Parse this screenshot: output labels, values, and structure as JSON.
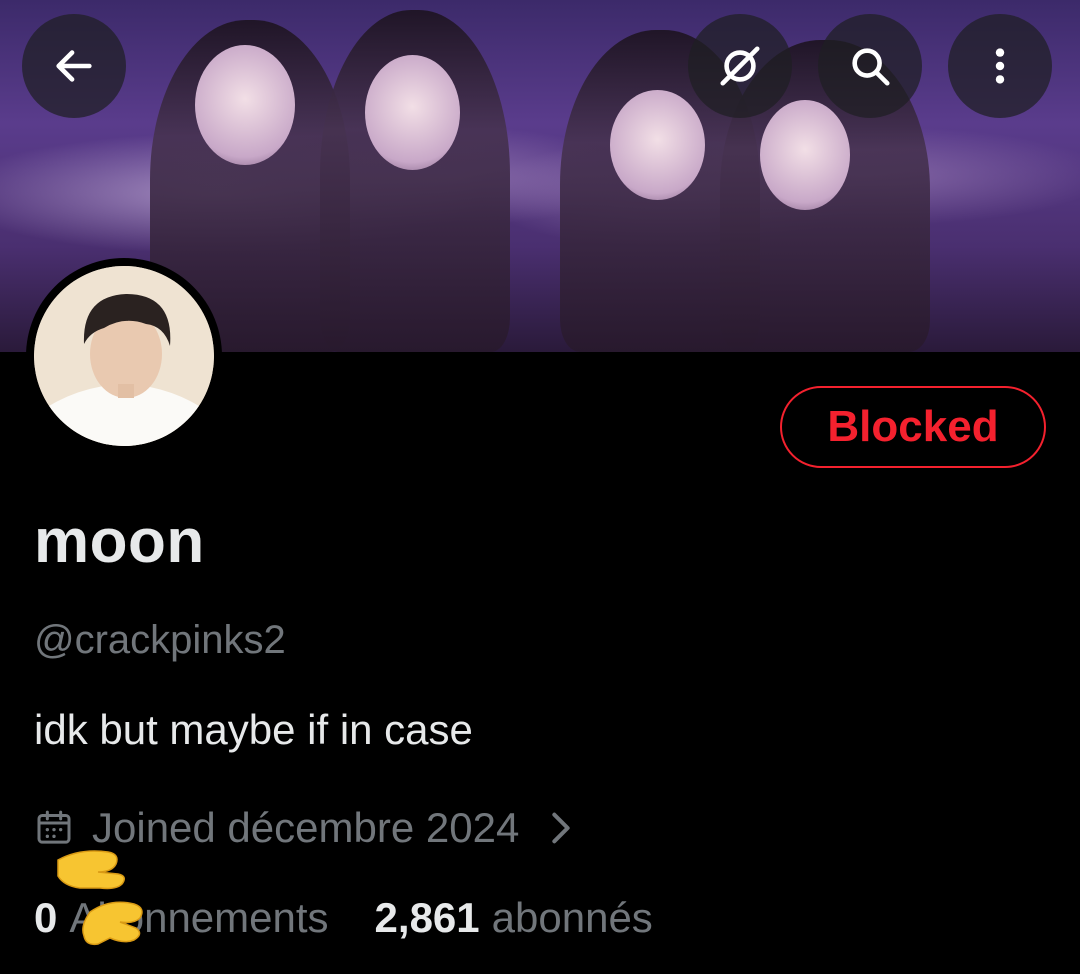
{
  "header": {
    "back_icon": "arrow-left-icon",
    "grok_icon": "grok-icon",
    "search_icon": "search-icon",
    "more_icon": "more-vertical-icon"
  },
  "profile": {
    "name": "moon",
    "handle": "@crackpinks2",
    "bio": "idk but maybe if in case",
    "joined": "Joined décembre 2024",
    "status_button": "Blocked"
  },
  "stats": {
    "following_count": "0",
    "following_label": "Abonnements",
    "followers_count": "2,861",
    "followers_label": "abonnés"
  },
  "colors": {
    "background": "#000000",
    "text_primary": "#e7e9ea",
    "text_secondary": "#71767b",
    "blocked_red": "#f4212e"
  }
}
